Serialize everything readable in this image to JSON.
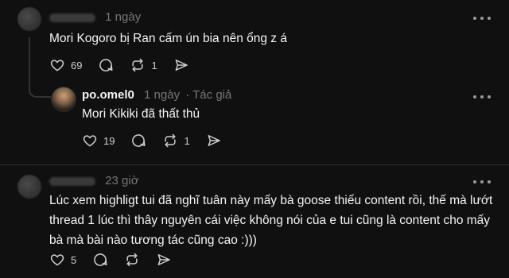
{
  "posts": [
    {
      "time": "1 ngày",
      "text": "Mori Kogoro bị Ran cấm ún bia nên ổng z á",
      "likes": "69",
      "comments": "",
      "reposts": "1"
    },
    {
      "username": "po.omel0",
      "time": "1 ngày",
      "badge": "· Tác giả",
      "text": "Mori Kikiki đã thất thủ",
      "likes": "19",
      "comments": "",
      "reposts": "1"
    },
    {
      "time": "23 giờ",
      "text_lines": [
        "Lúc xem highligt tui đã nghĩ tuân này mấy bà goose thiếu content rồi, thế mà lướt",
        "thread 1 lúc thì thây nguyên cái việc không nói của e tui cũng là content cho mấy",
        "bà mà bài nào tương tác cũng cao :)))"
      ],
      "likes": "5",
      "comments": "",
      "reposts": ""
    }
  ],
  "icons": [
    "heart-icon",
    "comment-icon",
    "repost-icon",
    "share-icon",
    "more-icon"
  ],
  "colors": {
    "background": "#101010",
    "text": "#f3f5f7",
    "muted": "#777777",
    "divider": "#2c2c2c"
  }
}
